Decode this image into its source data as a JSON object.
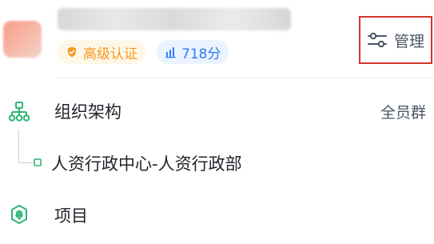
{
  "header": {
    "badges": {
      "certification": "高级认证",
      "score": "718分"
    },
    "manage_label": "管理"
  },
  "org": {
    "title": "组织架构",
    "tag": "全员群",
    "department": "人资行政中心-人资行政部"
  },
  "project": {
    "title": "项目"
  },
  "icons": {
    "org": "org-chart-icon",
    "project": "hexagon-project-icon",
    "manage": "sliders-icon",
    "certification": "verified-shield-icon",
    "score": "bar-chart-icon",
    "department_node": "tree-node-icon"
  },
  "colors": {
    "accent_green": "#2bb673",
    "certification_text": "#f59a23",
    "certification_bg": "#fff7e6",
    "score_text": "#2f7cf6",
    "score_bg": "#eaf3ff",
    "highlight_border": "#d4332a"
  }
}
